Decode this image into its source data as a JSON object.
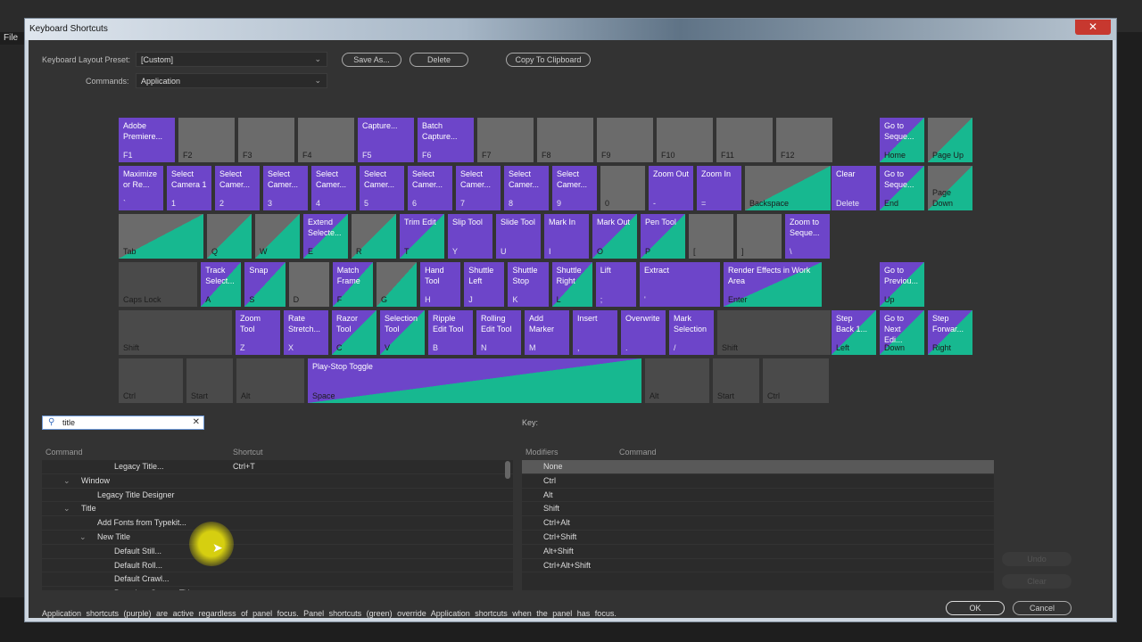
{
  "app": {
    "menu_file": "File"
  },
  "dialog": {
    "title": "Keyboard Shortcuts",
    "close_label": "✕"
  },
  "preset": {
    "label": "Keyboard Layout Preset:",
    "value": "[Custom]"
  },
  "commands": {
    "label": "Commands:",
    "value": "Application"
  },
  "buttons": {
    "save_as": "Save As...",
    "delete": "Delete",
    "copy": "Copy To Clipboard",
    "undo": "Undo",
    "clear": "Clear",
    "ok": "OK",
    "cancel": "Cancel"
  },
  "colors": {
    "application": "#6d45c9",
    "panel": "#17b890",
    "unassigned": "#6b6b6b"
  },
  "keyboard": {
    "rows": [
      [
        {
          "cap": "F1",
          "cmd": "Adobe Premiere...",
          "type": "app"
        },
        {
          "cap": "F2",
          "cmd": "",
          "type": "none"
        },
        {
          "cap": "F3",
          "cmd": "",
          "type": "none"
        },
        {
          "cap": "F4",
          "cmd": "",
          "type": "none"
        },
        {
          "cap": "F5",
          "cmd": "Capture...",
          "type": "app"
        },
        {
          "cap": "F6",
          "cmd": "Batch Capture...",
          "type": "app"
        },
        {
          "cap": "F7",
          "cmd": "",
          "type": "none"
        },
        {
          "cap": "F8",
          "cmd": "",
          "type": "none"
        },
        {
          "cap": "F9",
          "cmd": "",
          "type": "none"
        },
        {
          "cap": "F10",
          "cmd": "",
          "type": "none"
        },
        {
          "cap": "F11",
          "cmd": "",
          "type": "none"
        },
        {
          "cap": "F12",
          "cmd": "",
          "type": "none"
        }
      ],
      [
        {
          "cap": "`",
          "cmd": "Maximize or Re...",
          "type": "app"
        },
        {
          "cap": "1",
          "cmd": "Select Camera 1",
          "type": "app"
        },
        {
          "cap": "2",
          "cmd": "Select Camer...",
          "type": "app"
        },
        {
          "cap": "3",
          "cmd": "Select Camer...",
          "type": "app"
        },
        {
          "cap": "4",
          "cmd": "Select Camer...",
          "type": "app"
        },
        {
          "cap": "5",
          "cmd": "Select Camer...",
          "type": "app"
        },
        {
          "cap": "6",
          "cmd": "Select Camer...",
          "type": "app"
        },
        {
          "cap": "7",
          "cmd": "Select Camer...",
          "type": "app"
        },
        {
          "cap": "8",
          "cmd": "Select Camer...",
          "type": "app"
        },
        {
          "cap": "9",
          "cmd": "Select Camer...",
          "type": "app"
        },
        {
          "cap": "0",
          "cmd": "",
          "type": "none"
        },
        {
          "cap": "-",
          "cmd": "Zoom Out",
          "type": "app"
        },
        {
          "cap": "=",
          "cmd": "Zoom In",
          "type": "app"
        },
        {
          "cap": "Backspace",
          "cmd": "",
          "type": "panel"
        }
      ],
      [
        {
          "cap": "Tab",
          "cmd": "",
          "type": "panel"
        },
        {
          "cap": "Q",
          "cmd": "",
          "type": "panel"
        },
        {
          "cap": "W",
          "cmd": "",
          "type": "panel"
        },
        {
          "cap": "E",
          "cmd": "Extend Selecte...",
          "type": "both"
        },
        {
          "cap": "R",
          "cmd": "",
          "type": "panel"
        },
        {
          "cap": "T",
          "cmd": "Trim Edit",
          "type": "both"
        },
        {
          "cap": "Y",
          "cmd": "Slip Tool",
          "type": "app"
        },
        {
          "cap": "U",
          "cmd": "Slide Tool",
          "type": "app"
        },
        {
          "cap": "I",
          "cmd": "Mark In",
          "type": "app"
        },
        {
          "cap": "O",
          "cmd": "Mark Out",
          "type": "both"
        },
        {
          "cap": "P",
          "cmd": "Pen Tool",
          "type": "both"
        },
        {
          "cap": "[",
          "cmd": "",
          "type": "none"
        },
        {
          "cap": "]",
          "cmd": "",
          "type": "none"
        },
        {
          "cap": "\\",
          "cmd": "Zoom to Seque...",
          "type": "app"
        }
      ],
      [
        {
          "cap": "Caps Lock",
          "cmd": "",
          "type": "mod"
        },
        {
          "cap": "A",
          "cmd": "Track Select...",
          "type": "both"
        },
        {
          "cap": "S",
          "cmd": "Snap",
          "type": "both"
        },
        {
          "cap": "D",
          "cmd": "",
          "type": "none"
        },
        {
          "cap": "F",
          "cmd": "Match Frame",
          "type": "both"
        },
        {
          "cap": "G",
          "cmd": "",
          "type": "panel"
        },
        {
          "cap": "H",
          "cmd": "Hand Tool",
          "type": "app"
        },
        {
          "cap": "J",
          "cmd": "Shuttle Left",
          "type": "app"
        },
        {
          "cap": "K",
          "cmd": "Shuttle Stop",
          "type": "app"
        },
        {
          "cap": "L",
          "cmd": "Shuttle Right",
          "type": "both"
        },
        {
          "cap": ";",
          "cmd": "Lift",
          "type": "app"
        },
        {
          "cap": "'",
          "cmd": "Extract",
          "type": "app"
        },
        {
          "cap": "Enter",
          "cmd": "Render Effects in Work Area",
          "type": "both"
        }
      ],
      [
        {
          "cap": "Shift",
          "cmd": "",
          "type": "mod"
        },
        {
          "cap": "Z",
          "cmd": "Zoom Tool",
          "type": "app"
        },
        {
          "cap": "X",
          "cmd": "Rate Stretch...",
          "type": "app"
        },
        {
          "cap": "C",
          "cmd": "Razor Tool",
          "type": "both"
        },
        {
          "cap": "V",
          "cmd": "Selection Tool",
          "type": "both"
        },
        {
          "cap": "B",
          "cmd": "Ripple Edit Tool",
          "type": "app"
        },
        {
          "cap": "N",
          "cmd": "Rolling Edit Tool",
          "type": "app"
        },
        {
          "cap": "M",
          "cmd": "Add Marker",
          "type": "app"
        },
        {
          "cap": ",",
          "cmd": "Insert",
          "type": "app"
        },
        {
          "cap": ".",
          "cmd": "Overwrite",
          "type": "app"
        },
        {
          "cap": "/",
          "cmd": "Mark Selection",
          "type": "app"
        },
        {
          "cap": "Shift",
          "cmd": "",
          "type": "mod"
        }
      ],
      [
        {
          "cap": "Ctrl",
          "cmd": "",
          "type": "mod"
        },
        {
          "cap": "Start",
          "cmd": "",
          "type": "mod"
        },
        {
          "cap": "Alt",
          "cmd": "",
          "type": "mod"
        },
        {
          "cap": "Space",
          "cmd": "Play-Stop Toggle",
          "type": "both"
        },
        {
          "cap": "Alt",
          "cmd": "",
          "type": "mod"
        },
        {
          "cap": "Start",
          "cmd": "",
          "type": "mod"
        },
        {
          "cap": "Ctrl",
          "cmd": "",
          "type": "mod"
        }
      ]
    ],
    "nav": [
      {
        "cap": "Home",
        "cmd": "Go to Seque...",
        "type": "both"
      },
      {
        "cap": "Page Up",
        "cmd": "",
        "type": "panel"
      },
      {
        "cap": "Delete",
        "cmd": "Clear",
        "type": "app"
      },
      {
        "cap": "End",
        "cmd": "Go to Seque...",
        "type": "both"
      },
      {
        "cap": "Page Down",
        "cmd": "",
        "type": "panel"
      },
      {
        "cap": "Up",
        "cmd": "Go to Previou...",
        "type": "both"
      },
      {
        "cap": "Left",
        "cmd": "Step Back 1...",
        "type": "both"
      },
      {
        "cap": "Down",
        "cmd": "Go to Next Edi...",
        "type": "both"
      },
      {
        "cap": "Right",
        "cmd": "Step Forwar...",
        "type": "both"
      }
    ]
  },
  "search": {
    "value": "title"
  },
  "command_list": {
    "headers": {
      "command": "Command",
      "shortcut": "Shortcut"
    },
    "items": [
      {
        "label": "Legacy Title...",
        "shortcut": "Ctrl+T",
        "level": 3,
        "toggle": false
      },
      {
        "label": "Window",
        "shortcut": "",
        "level": 1,
        "toggle": true
      },
      {
        "label": "Legacy Title Designer",
        "shortcut": "",
        "level": 2,
        "toggle": false
      },
      {
        "label": "Title",
        "shortcut": "",
        "level": 1,
        "toggle": true
      },
      {
        "label": "Add Fonts from Typekit...",
        "shortcut": "",
        "level": 2,
        "toggle": false
      },
      {
        "label": "New Title",
        "shortcut": "",
        "level": 2,
        "toggle": true
      },
      {
        "label": "Default Still...",
        "shortcut": "",
        "level": 3,
        "toggle": false
      },
      {
        "label": "Default Roll...",
        "shortcut": "",
        "level": 3,
        "toggle": false
      },
      {
        "label": "Default Crawl...",
        "shortcut": "",
        "level": 3,
        "toggle": false
      },
      {
        "label": "Based on Current Title",
        "shortcut": "",
        "level": 3,
        "toggle": false
      }
    ]
  },
  "key_panel": {
    "label": "Key:",
    "headers": {
      "modifiers": "Modifiers",
      "command": "Command"
    },
    "modifiers": [
      "None",
      "Ctrl",
      "Alt",
      "Shift",
      "Ctrl+Alt",
      "Ctrl+Shift",
      "Alt+Shift",
      "Ctrl+Alt+Shift"
    ],
    "selected": "None"
  },
  "footer": "Application shortcuts (purple) are active regardless of panel focus. Panel shortcuts (green) override Application shortcuts when the panel has focus."
}
